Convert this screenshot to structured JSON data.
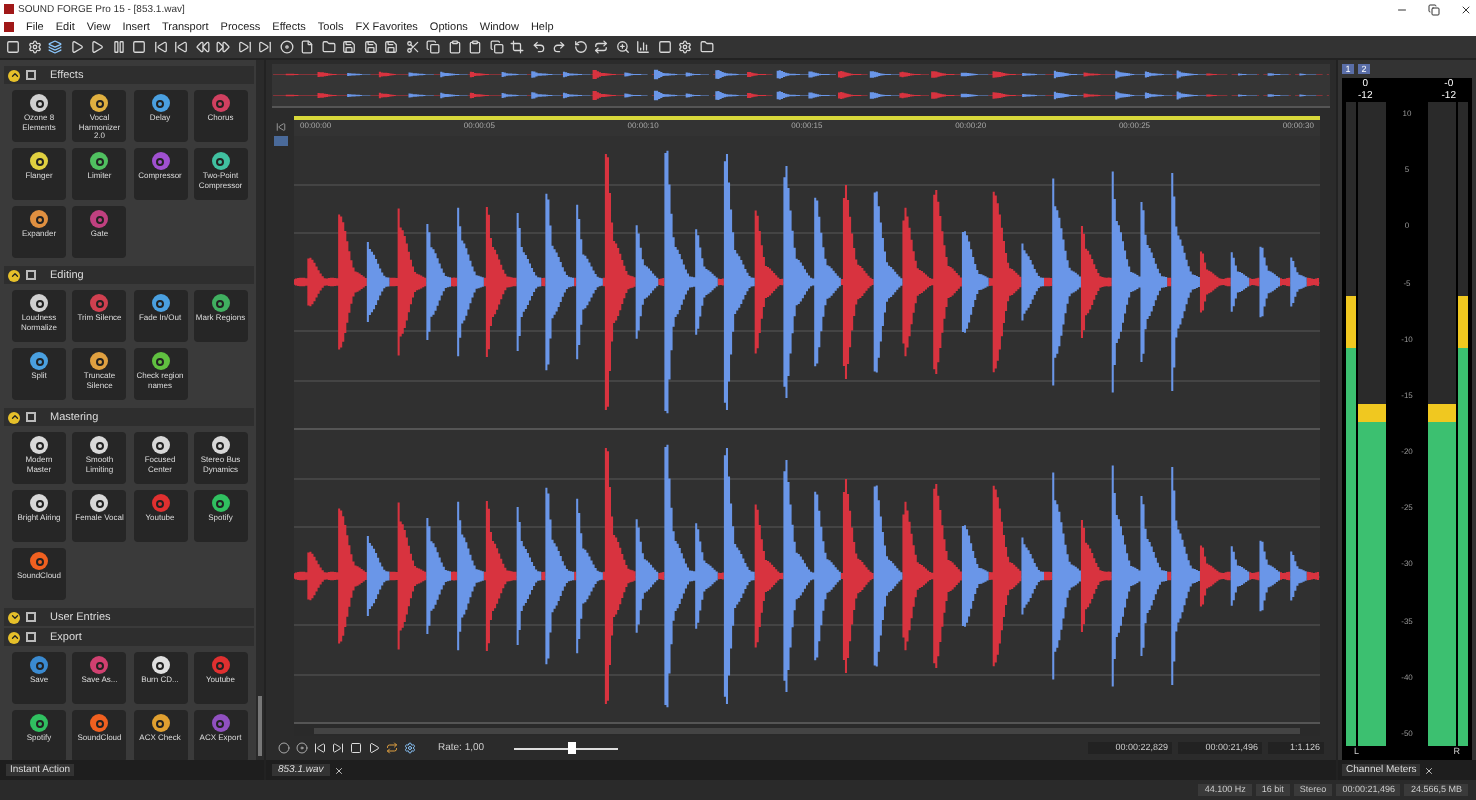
{
  "window": {
    "title": "SOUND FORGE Pro 15 - [853.1.wav]"
  },
  "menu": [
    "File",
    "Edit",
    "View",
    "Insert",
    "Transport",
    "Process",
    "Effects",
    "Tools",
    "FX Favorites",
    "Options",
    "Window",
    "Help"
  ],
  "instant_action": {
    "tab": "Instant Action",
    "sections": [
      {
        "title": "Effects",
        "expanded": true,
        "tiles": [
          {
            "label": "Ozone 8 Elements",
            "color": "#d0d0d0"
          },
          {
            "label": "Vocal Harmonizer 2.0",
            "color": "#e0b040"
          },
          {
            "label": "Delay",
            "color": "#4aa0e0"
          },
          {
            "label": "Chorus",
            "color": "#d04060"
          },
          {
            "label": "Flanger",
            "color": "#e0d040"
          },
          {
            "label": "Limiter",
            "color": "#50c060"
          },
          {
            "label": "Compressor",
            "color": "#a050d0"
          },
          {
            "label": "Two-Point Compressor",
            "color": "#40c0a0"
          },
          {
            "label": "Expander",
            "color": "#e09040"
          },
          {
            "label": "Gate",
            "color": "#c04080"
          }
        ]
      },
      {
        "title": "Editing",
        "expanded": true,
        "tiles": [
          {
            "label": "Loudness Normalize",
            "color": "#d0d0d0"
          },
          {
            "label": "Trim Silence",
            "color": "#d04050"
          },
          {
            "label": "Fade In/Out",
            "color": "#4aa0e0"
          },
          {
            "label": "Mark Regions",
            "color": "#40b060"
          },
          {
            "label": "Split",
            "color": "#4aa0e0"
          },
          {
            "label": "Truncate Silence",
            "color": "#e0a040"
          },
          {
            "label": "Check region names",
            "color": "#60c040"
          }
        ]
      },
      {
        "title": "Mastering",
        "expanded": true,
        "tiles": [
          {
            "label": "Modern Master",
            "color": "#d8d8d8"
          },
          {
            "label": "Smooth Limiting",
            "color": "#d8d8d8"
          },
          {
            "label": "Focused Center",
            "color": "#d8d8d8"
          },
          {
            "label": "Stereo Bus Dynamics",
            "color": "#d8d8d8"
          },
          {
            "label": "Bright Airing",
            "color": "#d8d8d8"
          },
          {
            "label": "Female Vocal",
            "color": "#d8d8d8"
          },
          {
            "label": "Youtube",
            "color": "#e03030"
          },
          {
            "label": "Spotify",
            "color": "#30c060"
          },
          {
            "label": "SoundCloud",
            "color": "#f06020"
          }
        ]
      },
      {
        "title": "User Entries",
        "expanded": false
      },
      {
        "title": "Export",
        "expanded": true,
        "tiles": [
          {
            "label": "Save",
            "color": "#3a8ad0"
          },
          {
            "label": "Save As...",
            "color": "#d04070"
          },
          {
            "label": "Burn CD...",
            "color": "#e0e0e0"
          },
          {
            "label": "Youtube",
            "color": "#e03030"
          },
          {
            "label": "Spotify",
            "color": "#30c060"
          },
          {
            "label": "SoundCloud",
            "color": "#f06020"
          },
          {
            "label": "ACX Check",
            "color": "#e0a030"
          },
          {
            "label": "ACX Export",
            "color": "#9050c0"
          }
        ]
      }
    ]
  },
  "editor": {
    "ruler": [
      "00:00:00",
      "00:00:05",
      "00:00:10",
      "00:00:15",
      "00:00:20",
      "00:00:25",
      "00:00:30"
    ],
    "transport": {
      "rate": "Rate: 1,00",
      "level": 0.55,
      "fields": [
        "00:00:22,829",
        "00:00:21,496",
        "1:1.126"
      ]
    },
    "tab": "853.1.wav"
  },
  "meters": {
    "tab": "Channel Meters",
    "buttons": [
      {
        "label": "1"
      },
      {
        "label": "2"
      }
    ],
    "scale": [
      "10",
      "5",
      "0",
      "-5",
      "-10",
      "-15",
      "-20",
      "-25",
      "-30",
      "-35",
      "-40",
      "-50"
    ],
    "channels": [
      {
        "name": "L",
        "peak": "0",
        "rms": "-12",
        "bars": [
          {
            "kind": "peak",
            "level": 0.7
          },
          {
            "kind": "rms",
            "level": 0.53
          }
        ]
      },
      {
        "name": "R",
        "peak": "-0",
        "rms": "-12",
        "bars": [
          {
            "kind": "rms",
            "level": 0.53
          },
          {
            "kind": "peak",
            "level": 0.7
          }
        ]
      }
    ]
  },
  "status_bar": [
    "44.100 Hz",
    "16 bit",
    "Stereo",
    "00:00:21,496",
    "24.566,5 MB"
  ]
}
